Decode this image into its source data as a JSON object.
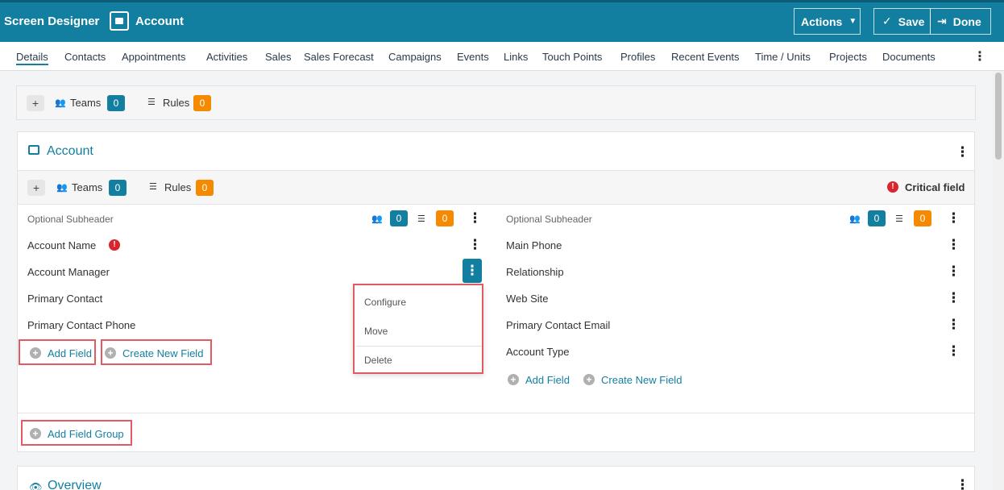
{
  "header": {
    "breadcrumb": "Screen Designer",
    "chevron": "›",
    "title": "Account",
    "actions_label": "Actions",
    "save_label": "Save",
    "done_label": "Done",
    "bg_color": "#137fa0"
  },
  "tabs": [
    "Details",
    "Contacts",
    "Appointments",
    "Activities",
    "Sales",
    "Sales Forecast",
    "Campaigns",
    "Events",
    "Links",
    "Touch Points",
    "Profiles",
    "Recent Events",
    "Time / Units",
    "Projects",
    "Documents"
  ],
  "top_bar": {
    "teams_label": "Teams",
    "teams_count": "0",
    "rules_label": "Rules",
    "rules_count": "0"
  },
  "account_section": {
    "title": "Account",
    "teams_label": "Teams",
    "teams_count": "0",
    "rules_label": "Rules",
    "rules_count": "0",
    "critical_label": "Critical field",
    "left_column": {
      "subheader": "Optional Subheader",
      "teams_count": "0",
      "rules_count": "0",
      "fields": [
        "Account Name",
        "Account Manager",
        "Primary Contact",
        "Primary Contact Phone"
      ],
      "add_field": "Add Field",
      "create_new_field": "Create New Field"
    },
    "right_column": {
      "subheader": "Optional Subheader",
      "teams_count": "0",
      "rules_count": "0",
      "fields": [
        "Main Phone",
        "Relationship",
        "Web Site",
        "Primary Contact Email",
        "Account Type"
      ],
      "add_field": "Add Field",
      "create_new_field": "Create New Field"
    },
    "add_field_group": "Add Field Group"
  },
  "context_menu": [
    "Configure",
    "Move",
    "Delete"
  ],
  "overview_section": {
    "title": "Overview"
  },
  "colors": {
    "accent": "#137fa0",
    "orange": "#f58a00",
    "critical": "#d9252e",
    "highlight": "#e35a63"
  }
}
